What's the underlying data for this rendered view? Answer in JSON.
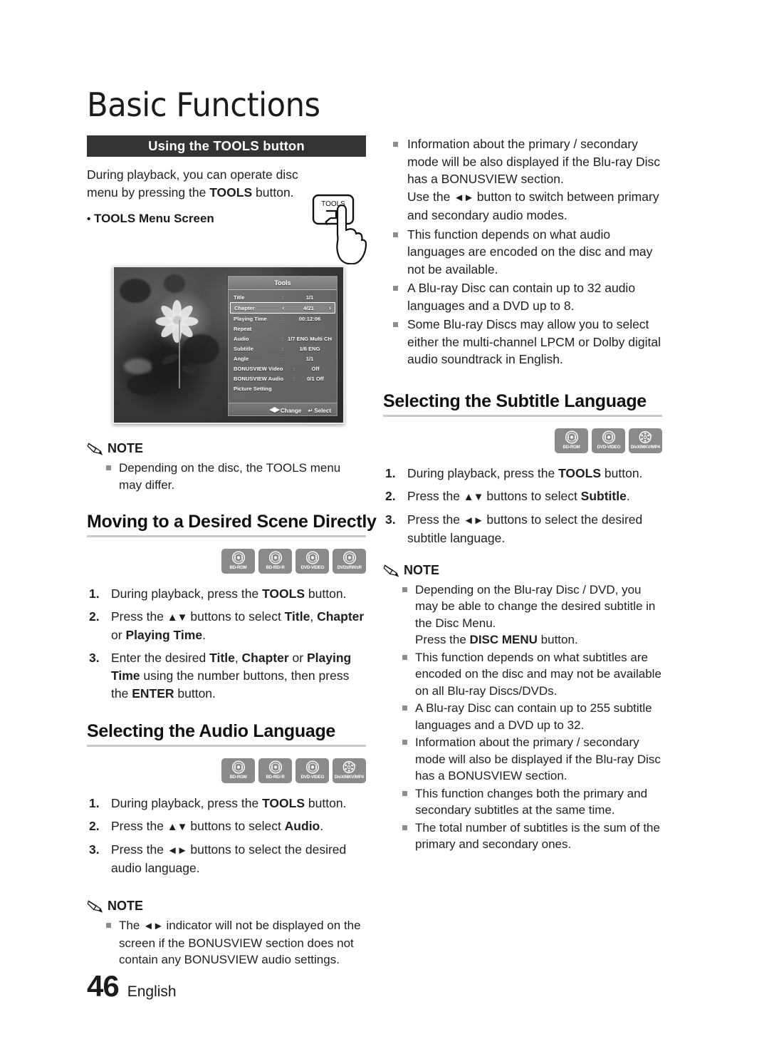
{
  "page": {
    "chapter_title": "Basic Functions",
    "page_number": "46",
    "language": "English"
  },
  "left": {
    "section_bar": "Using the TOOLS button",
    "intro_text_1": "During playback, you can operate disc menu by pressing the ",
    "intro_bold": "TOOLS",
    "intro_text_2": " button.",
    "tools_key_label": "TOOLS",
    "menu_screen_label": "TOOLS Menu Screen",
    "note1": {
      "title": "NOTE",
      "items": [
        "Depending on the disc, the TOOLS menu may differ."
      ]
    },
    "scene_heading": "Moving to a Desired Scene Directly",
    "scene_badges": [
      "BD-ROM",
      "BD-RE/-R",
      "DVD-VIDEO",
      "DVD±RW/±R"
    ],
    "scene_badge_icons": [
      "disc-icon",
      "disc-icon",
      "disc-icon",
      "disc-icon"
    ],
    "scene_steps": [
      {
        "num": "1.",
        "html": "During playback, press the <b>TOOLS</b> button."
      },
      {
        "num": "2.",
        "html": "Press the <span class=\"arrowch\">▲▼</span> buttons to select <b>Title</b>, <b>Chapter</b> or <b>Playing Time</b>."
      },
      {
        "num": "3.",
        "html": "Enter the desired <b>Title</b>, <b>Chapter</b> or <b>Playing Time</b> using the number buttons, then press the <b>ENTER</b> button."
      }
    ],
    "audio_heading": "Selecting the Audio Language",
    "audio_badges": [
      "BD-ROM",
      "BD-RE/-R",
      "DVD-VIDEO",
      "DivX/MKV/MP4"
    ],
    "audio_badge_icons": [
      "disc-icon",
      "disc-icon",
      "disc-icon",
      "film-icon"
    ],
    "audio_steps": [
      {
        "num": "1.",
        "html": "During playback, press the <b>TOOLS</b> button."
      },
      {
        "num": "2.",
        "html": "Press the <span class=\"arrowch\">▲▼</span> buttons to select <b>Audio</b>."
      },
      {
        "num": "3.",
        "html": "Press the <span class=\"arrowch\">◄►</span> buttons to select the desired audio language."
      }
    ],
    "note2": {
      "title": "NOTE",
      "items_html": [
        "The <span class=\"arrowch\">◄►</span> indicator will not be displayed on the screen if the BONUSVIEW section does not contain any BONUSVIEW audio settings."
      ]
    }
  },
  "tools_menu_screen": {
    "title": "Tools",
    "rows": [
      {
        "label": "Title",
        "sep": ":",
        "value": "1/1",
        "selected": false
      },
      {
        "label": "Chapter",
        "sep": "",
        "value": "4/21",
        "selected": true,
        "left_arrow": "‹",
        "right_arrow": "›"
      },
      {
        "label": "Playing Time",
        "sep": ":",
        "value": "00:12:06",
        "selected": false
      },
      {
        "label": "Repeat",
        "sep": "",
        "value": "",
        "selected": false
      },
      {
        "label": "Audio",
        "sep": ":",
        "value": "1/7 ENG Multi CH",
        "selected": false
      },
      {
        "label": "Subtitle",
        "sep": ":",
        "value": "1/6 ENG",
        "selected": false
      },
      {
        "label": "Angle",
        "sep": ":",
        "value": "1/1",
        "selected": false
      },
      {
        "label": "BONUSVIEW Video",
        "sep": ":",
        "value": "Off",
        "selected": false
      },
      {
        "label": "BONUSVIEW Audio",
        "sep": ":",
        "value": "0/1 Off",
        "selected": false
      },
      {
        "label": "Picture Setting",
        "sep": "",
        "value": "",
        "selected": false
      }
    ],
    "footer_change": "Change",
    "footer_select": "Select"
  },
  "right": {
    "top_bullets_html": [
      "Information about the primary / secondary mode will be also displayed if the Blu-ray Disc has a BONUSVIEW section.<br>Use the <span class=\"arrowch\">◄►</span> button to switch between primary and secondary audio modes.",
      "This function depends on what audio languages are encoded on the disc and may not be available.",
      "A Blu-ray Disc can contain up to 32 audio languages and a DVD up to 8.",
      "Some Blu-ray Discs may allow you to select either the multi-channel LPCM or Dolby digital audio soundtrack in English."
    ],
    "subtitle_heading": "Selecting the Subtitle Language",
    "subtitle_badges": [
      "BD-ROM",
      "DVD-VIDEO",
      "DivX/MKV/MP4"
    ],
    "subtitle_badge_icons": [
      "disc-icon",
      "disc-icon",
      "film-icon"
    ],
    "subtitle_steps": [
      {
        "num": "1.",
        "html": "During playback, press the <b>TOOLS</b> button."
      },
      {
        "num": "2.",
        "html": "Press the <span class=\"arrowch\">▲▼</span> buttons to select <b>Subtitle</b>."
      },
      {
        "num": "3.",
        "html": "Press the <span class=\"arrowch\">◄►</span> buttons to select the desired subtitle language."
      }
    ],
    "note": {
      "title": "NOTE",
      "items_html": [
        "Depending on the Blu-ray Disc / DVD, you may be able to change the desired subtitle in the Disc Menu.<br>Press the <b>DISC MENU</b> button.",
        "This function depends on what subtitles are encoded on the disc and may not be available on all Blu-ray Discs/DVDs.",
        "A Blu-ray Disc can contain up to 255 subtitle languages and a DVD up to 32.",
        "Information about the primary / secondary mode will also be displayed if the Blu-ray Disc has a BONUSVIEW section.",
        "This function changes both the primary and secondary subtitles at the same time.",
        "The total number of subtitles is the sum of the primary and secondary ones."
      ]
    }
  },
  "colors": {
    "section_bar_bg": "#333333",
    "rule": "#c9c9c9",
    "badge_bg": "#8a8a8a",
    "bullet_square": "#8d8d8d",
    "text": "#1f1f1f"
  }
}
